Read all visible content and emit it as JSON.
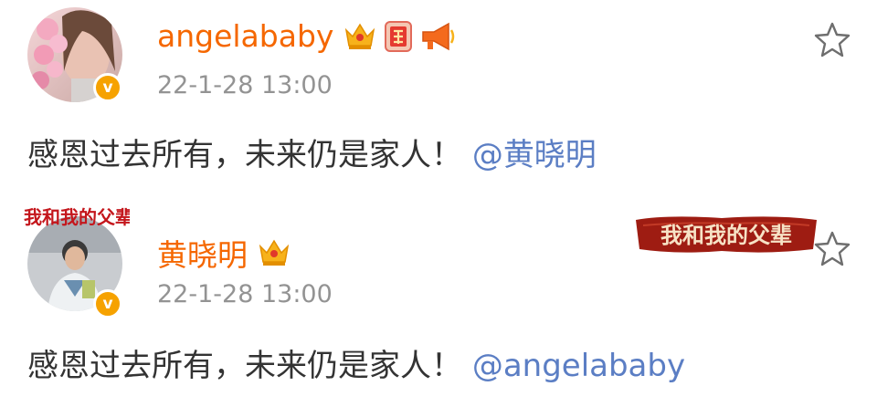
{
  "posts": [
    {
      "username": "angelababy",
      "timestamp": "22-1-28 13:00",
      "content": "感恩过去所有，未来仍是家人！",
      "mention": "@黄晓明",
      "badges": [
        "crown-badge-icon",
        "fu-badge-icon",
        "megaphone-badge-icon"
      ],
      "verified_symbol": "v"
    },
    {
      "username": "黄晓明",
      "timestamp": "22-1-28 13:00",
      "content": "感恩过去所有，未来仍是家人！",
      "mention": "@angelababy",
      "badges": [
        "crown-badge-icon"
      ],
      "verified_symbol": "v",
      "avatar_frame_text": "我和我的父辈",
      "card_banner_text": "我和我的父辈"
    }
  ],
  "colors": {
    "username": "#f56700",
    "timestamp": "#939393",
    "content": "#333333",
    "mention": "#5b7ec4",
    "verified": "#f6a200",
    "banner": "#9e1c12"
  }
}
